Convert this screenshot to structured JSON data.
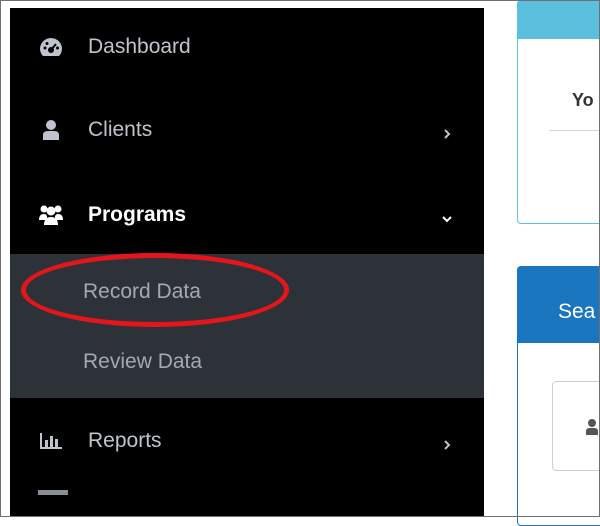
{
  "sidebar": {
    "items": [
      {
        "label": "Dashboard",
        "icon": "dashboard-icon"
      },
      {
        "label": "Clients",
        "icon": "user-icon"
      },
      {
        "label": "Programs",
        "icon": "users-icon"
      },
      {
        "label": "Reports",
        "icon": "bar-chart-icon"
      }
    ],
    "submenu": [
      {
        "label": "Record Data"
      },
      {
        "label": "Review Data"
      }
    ]
  },
  "main": {
    "top_panel_text": "Yo",
    "search_panel_title": "Sea"
  },
  "colors": {
    "sidebar_bg": "#000000",
    "submenu_bg": "#2c3238",
    "highlight": "#e5161b",
    "info": "#5bc0de",
    "primary": "#1a76bf"
  }
}
